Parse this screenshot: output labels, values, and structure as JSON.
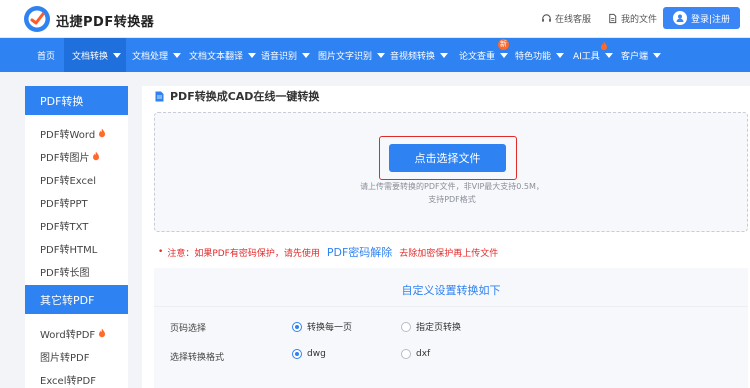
{
  "header": {
    "brand": "迅捷PDF转换器",
    "service": "在线客服",
    "files": "我的文件",
    "login": "登录|注册"
  },
  "nav": {
    "items": [
      {
        "label": "首页"
      },
      {
        "label": "文档转换"
      },
      {
        "label": "文档处理"
      },
      {
        "label": "文档文本翻译"
      },
      {
        "label": "语音识别"
      },
      {
        "label": "图片文字识别"
      },
      {
        "label": "音视频转换"
      },
      {
        "label": "论文查重"
      },
      {
        "label": "特色功能"
      },
      {
        "label": "AI工具"
      },
      {
        "label": "客户端"
      }
    ],
    "badge": "新"
  },
  "sidebar": {
    "group1_title": "PDF转换",
    "group1": [
      {
        "label": "PDF转Word"
      },
      {
        "label": "PDF转图片"
      },
      {
        "label": "PDF转Excel"
      },
      {
        "label": "PDF转PPT"
      },
      {
        "label": "PDF转TXT"
      },
      {
        "label": "PDF转HTML"
      },
      {
        "label": "PDF转长图"
      }
    ],
    "group2_title": "其它转PDF",
    "group2": [
      {
        "label": "Word转PDF"
      },
      {
        "label": "图片转PDF"
      },
      {
        "label": "Excel转PDF"
      }
    ]
  },
  "main": {
    "title": "PDF转换成CAD在线一键转换",
    "upload": {
      "button": "点击选择文件",
      "hint_line1": "请上传需要转换的PDF文件，非VIP最大支持0.5M，",
      "hint_line2": "支持PDF格式"
    },
    "notice": {
      "prefix": "注意：如果PDF有密码保护，请先使用",
      "link": "PDF密码解除",
      "suffix": "去除加密保护再上传文件"
    },
    "settings": {
      "title": "自定义设置转换如下",
      "page_label": "页码选择",
      "page_opt_all": "转换每一页",
      "page_opt_range": "指定页转换",
      "format_label": "选择转换格式",
      "format_opt_dwg": "dwg",
      "format_opt_dxf": "dxf"
    }
  },
  "colors": {
    "brand_blue": "#2f82f2",
    "nav_active": "#1f6fdc",
    "warning_red": "#e32a2a",
    "hot_orange": "#ff6a2c"
  },
  "icons": {
    "logo": "logo-icon",
    "service": "headset-icon",
    "files": "file-icon",
    "user": "user-icon",
    "hot": "fire-icon",
    "title": "document-icon"
  }
}
